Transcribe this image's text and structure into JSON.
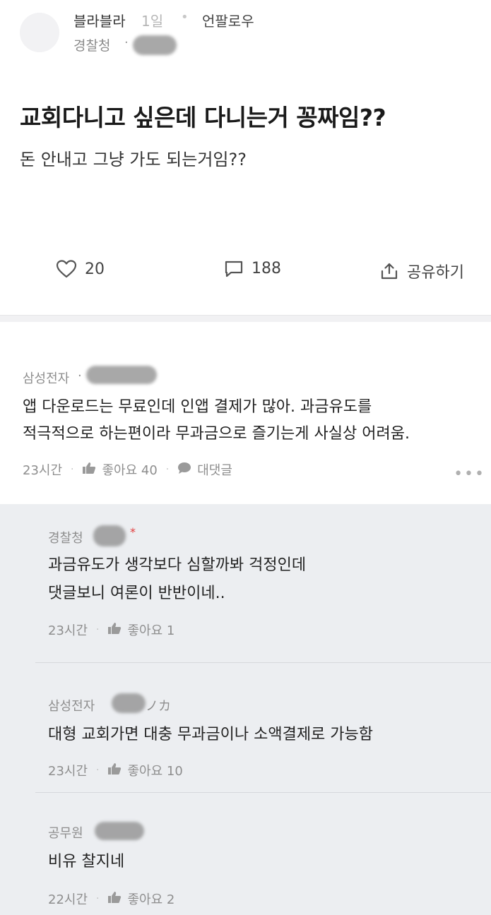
{
  "post": {
    "author": "블라블라",
    "time": "1일",
    "separator": "•",
    "unfollow_label": "언팔로우",
    "company": "경찰청",
    "company_dot": "·",
    "title": "교회다니고 싶은데 다니는거 꽁짜임??",
    "body": "돈 안내고 그냥 가도 되는거임??",
    "likes": "20",
    "comments": "188",
    "share_label": "공유하기"
  },
  "comment": {
    "company": "삼성전자",
    "company_dot": "·",
    "line1": "앱 다운로드는 무료인데 인앱 결제가 많아. 과금유도를",
    "line2": "적극적으로 하는편이라 무과금으로 즐기는게 사실상 어려움.",
    "time": "23시간",
    "like_label": "좋아요 40",
    "reply_label": "대댓글",
    "more": "•••"
  },
  "replies": [
    {
      "company": "경찰청",
      "badge": "*",
      "line1": "과금유도가 생각보다 심할까봐 걱정인데",
      "line2": "댓글보니 여론이 반반이네..",
      "time": "23시간",
      "like_label": "좋아요 1"
    },
    {
      "company": "삼성전자",
      "nick_tail": "ノカ",
      "line1": "대형 교회가면 대충 무과금이나 소액결제로 가능함",
      "time": "23시간",
      "like_label": "좋아요 10"
    },
    {
      "company": "공무원",
      "line1": "비유 찰지네",
      "time": "22시간",
      "like_label": "좋아요 2"
    }
  ],
  "footer_separator": "·",
  "icons": {
    "like": "heart-icon",
    "comment": "comment-bubble-icon",
    "share": "share-icon",
    "thumb": "thumbs-up-icon",
    "reply_bubble": "speech-bubble-icon",
    "more": "more-dots-icon"
  }
}
